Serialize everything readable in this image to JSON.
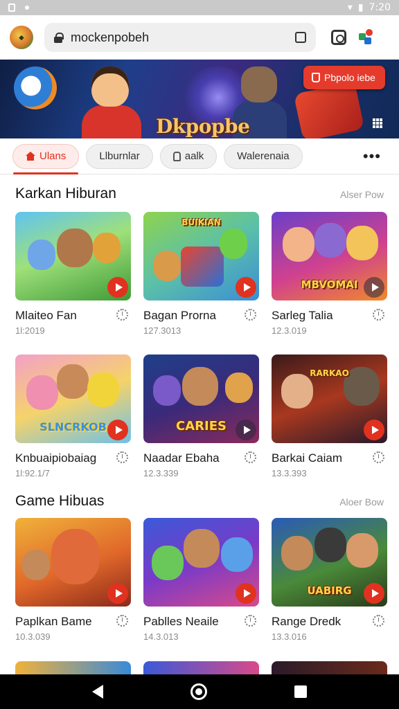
{
  "status_bar": {
    "time": "7:20"
  },
  "browser": {
    "url": "mockenpobeh"
  },
  "banner": {
    "title": "Dkpopbe",
    "cta_label": "Pbpolo iebe"
  },
  "tabs": [
    {
      "label": "Ulans"
    },
    {
      "label": "Llburnlar"
    },
    {
      "label": "aalk"
    },
    {
      "label": "Walerenaia"
    }
  ],
  "more_label": "•••",
  "sections": [
    {
      "title": "Karkan Hiburan",
      "link": "Alser Pow",
      "cards": [
        {
          "title": "Mlaiteo Fan",
          "meta": "1l:2019",
          "thumb_text": ""
        },
        {
          "title": "Bagan Prorna",
          "meta": "127.3013",
          "thumb_text": "BUIKIAN"
        },
        {
          "title": "Sarleg Talia",
          "meta": "12.3.019",
          "thumb_text": "MBVOMAI"
        },
        {
          "title": "Knbuaipiobaiag",
          "meta": "1l:92.1/7",
          "thumb_text": "SLNCRKOB"
        },
        {
          "title": "Naadar Ebaha",
          "meta": "12.3.339",
          "thumb_text": "CARIES"
        },
        {
          "title": "Barkai Caiam",
          "meta": "13.3.393",
          "thumb_text": "RARKAO"
        }
      ]
    },
    {
      "title": "Game Hibuas",
      "link": "Aloer Bow",
      "cards": [
        {
          "title": "Paplkan Bame",
          "meta": "10.3.039",
          "thumb_text": ""
        },
        {
          "title": "Pablles Neaile",
          "meta": "14.3.013",
          "thumb_text": ""
        },
        {
          "title": "Range Dredk",
          "meta": "13.3.016",
          "thumb_text": "UABIRG"
        }
      ]
    }
  ]
}
